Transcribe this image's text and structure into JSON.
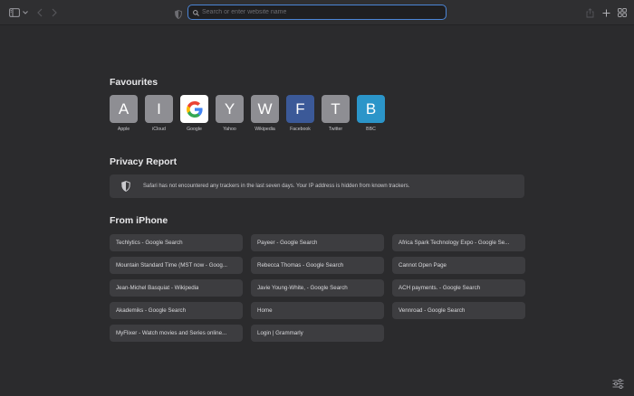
{
  "toolbar": {
    "icons": [
      "sidebar-icon",
      "chevron-down-icon",
      "back-icon",
      "forward-icon",
      "shield-icon",
      "search-icon",
      "share-icon",
      "plus-icon",
      "tab-overview-icon"
    ],
    "address_placeholder": "Search or enter website name"
  },
  "favourites": {
    "title": "Favourites",
    "items": [
      {
        "letter": "A",
        "label": "Apple",
        "color": "#8e8e93"
      },
      {
        "letter": "I",
        "label": "iCloud",
        "color": "#8e8e93"
      },
      {
        "letter": "G",
        "label": "Google",
        "color": "#ffffff"
      },
      {
        "letter": "Y",
        "label": "Yahoo",
        "color": "#8e8e93"
      },
      {
        "letter": "W",
        "label": "Wikipedia",
        "color": "#8e8e93"
      },
      {
        "letter": "F",
        "label": "Facebook",
        "color": "#3b5998"
      },
      {
        "letter": "T",
        "label": "Twitter",
        "color": "#8e8e93"
      },
      {
        "letter": "B",
        "label": "BBC",
        "color": "#2b95c9"
      }
    ]
  },
  "privacy_report": {
    "title": "Privacy Report",
    "message": "Safari has not encountered any trackers in the last seven days. Your IP address is hidden from known trackers."
  },
  "from_iphone": {
    "title": "From iPhone",
    "items": [
      "Techlytics - Google Search",
      "Payeer - Google Search",
      "Africa Spark Technology Expo - Google Se...",
      "Mountain Standard Time (MST now - Goog...",
      "Rebecca Thomas - Google Search",
      "Cannot Open Page",
      "Jean-Michel Basquiat - Wikipedia",
      "Javie Young-White, - Google Search",
      "ACH payments. - Google Search",
      "Akademiks - Google Search",
      "Home",
      "Vennroad - Google Search",
      "MyFlixer - Watch movies and Series online...",
      "Login | Grammarly"
    ]
  },
  "colors": {
    "background": "#2b2b2d",
    "accent": "#4b85d6",
    "card": "#3d3d40"
  }
}
